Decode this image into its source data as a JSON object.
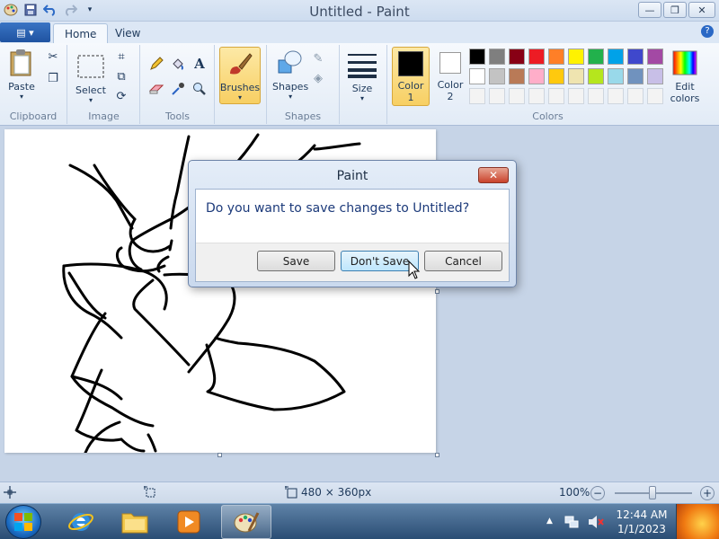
{
  "window": {
    "title": "Untitled - Paint",
    "minimize_glyph": "—",
    "restore_glyph": "❐",
    "close_glyph": "✕"
  },
  "ribbon_tabs": {
    "file_glyph": "▤ ▾",
    "home": "Home",
    "view": "View",
    "help": "?"
  },
  "ribbon": {
    "clipboard": {
      "paste": "Paste",
      "label": "Clipboard"
    },
    "image": {
      "select": "Select",
      "label": "Image"
    },
    "tools": {
      "label": "Tools",
      "text_glyph": "A"
    },
    "brushes": {
      "label": "Brushes"
    },
    "shapes": {
      "shapes": "Shapes",
      "label": "Shapes"
    },
    "size": {
      "label": "Size"
    },
    "colors": {
      "color1": "Color\n1",
      "color2": "Color\n2",
      "edit_colors": "Edit\ncolors",
      "label": "Colors",
      "color1_value": "#000000",
      "color2_value": "#ffffff",
      "palette_row1": [
        "#000000",
        "#7f7f7f",
        "#880015",
        "#ed1c24",
        "#ff7f27",
        "#fff200",
        "#22b14c",
        "#00a2e8",
        "#3f48cc",
        "#a349a4"
      ],
      "palette_row2": [
        "#ffffff",
        "#c3c3c3",
        "#b97a57",
        "#ffaec9",
        "#ffc90e",
        "#efe4b0",
        "#b5e61d",
        "#99d9ea",
        "#7092be",
        "#c8bfe7"
      ],
      "palette_row3": [
        "#f3f3f3",
        "#f3f3f3",
        "#f3f3f3",
        "#f3f3f3",
        "#f3f3f3",
        "#f3f3f3",
        "#f3f3f3",
        "#f3f3f3",
        "#f3f3f3",
        "#f3f3f3"
      ]
    }
  },
  "dialog": {
    "title": "Paint",
    "message": "Do you want to save changes to Untitled?",
    "save": "Save",
    "dont_save": "Don't Save",
    "cancel": "Cancel",
    "close_glyph": "✕"
  },
  "statusbar": {
    "dimensions": "480 × 360px",
    "zoom": "100%",
    "zoom_out": "−",
    "zoom_in": "+"
  },
  "taskbar": {
    "time": "12:44 AM",
    "date": "1/1/2023",
    "tray_arrow": "▲"
  }
}
